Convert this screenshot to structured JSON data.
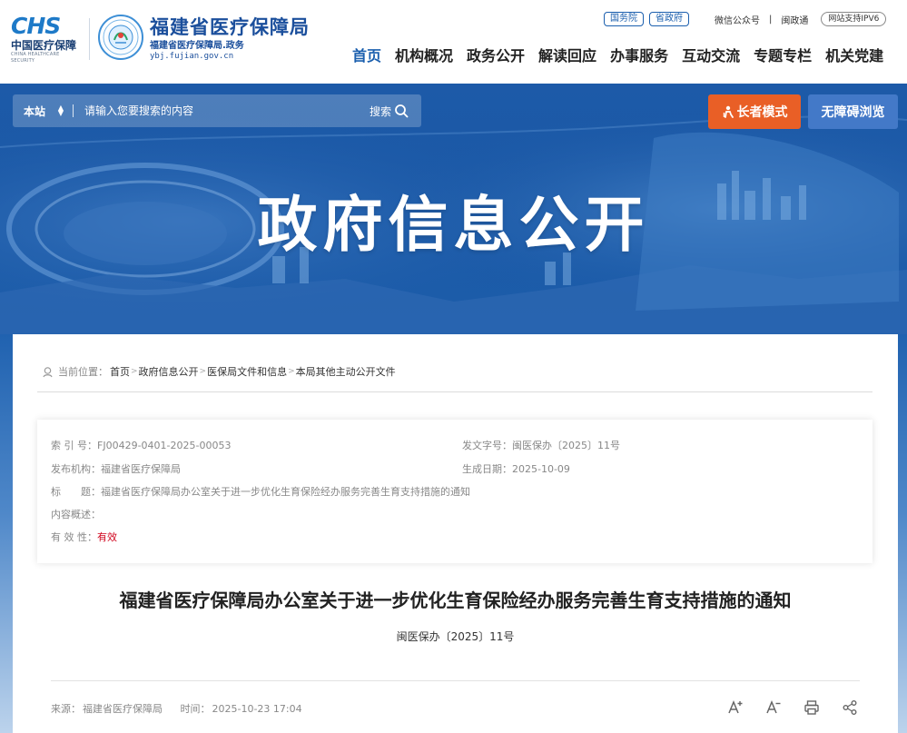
{
  "header": {
    "chs_mark": "CHS",
    "chs_cn": "中国医疗保障",
    "chs_en": "CHINA HEALTHCARE SECURITY",
    "site_name": "福建省医疗保障局",
    "site_sub": "福建省医疗保障局.政务",
    "site_url": "ybj.fujian.gov.cn",
    "pill_1": "国务院",
    "pill_2": "省政府",
    "wechat": "微信公众号",
    "divider": "|",
    "min_zheng_tong": "闽政通",
    "ipv6": "网站支持IPV6"
  },
  "nav": {
    "items": [
      "首页",
      "机构概况",
      "政务公开",
      "解读回应",
      "办事服务",
      "互动交流",
      "专题专栏",
      "机关党建"
    ]
  },
  "search": {
    "scope": "本站",
    "placeholder": "请输入您要搜索的内容",
    "button": "搜索"
  },
  "buttons": {
    "elder_mode": "长者模式",
    "accessible": "无障碍浏览"
  },
  "banner": {
    "title": "政府信息公开"
  },
  "breadcrumb": {
    "label": "当前位置：",
    "items": [
      "首页",
      "政府信息公开",
      "医保局文件和信息",
      "本局其他主动公开文件"
    ]
  },
  "meta": {
    "index_label": "索 引 号：",
    "index_value": "FJ00429-0401-2025-00053",
    "doc_no_label": "发文字号：",
    "doc_no_value": "闽医保办〔2025〕11号",
    "issuer_label": "发布机构：",
    "issuer_value": "福建省医疗保障局",
    "date_label": "生成日期：",
    "date_value": "2025-10-09",
    "title_label": "标　　题：",
    "title_value": "福建省医疗保障局办公室关于进一步优化生育保险经办服务完善生育支持措施的通知",
    "summary_label": "内容概述：",
    "summary_value": "",
    "validity_label": "有 效 性：",
    "validity_value": "有效"
  },
  "article": {
    "title": "福建省医疗保障局办公室关于进一步优化生育保险经办服务完善生育支持措施的通知",
    "doc_no": "闽医保办〔2025〕11号",
    "source_label": "来源：",
    "source_value": "福建省医疗保障局",
    "time_label": "时间：",
    "time_value": "2025-10-23 17:04"
  },
  "icons": {
    "font_increase": "font-increase-icon",
    "font_decrease": "font-decrease-icon",
    "print": "print-icon",
    "share": "share-icon"
  },
  "colors": {
    "brand_blue": "#1b5fae",
    "banner_blue": "#1d5aa8",
    "elder_orange": "#e95f26",
    "valid_red": "#d0021b"
  }
}
